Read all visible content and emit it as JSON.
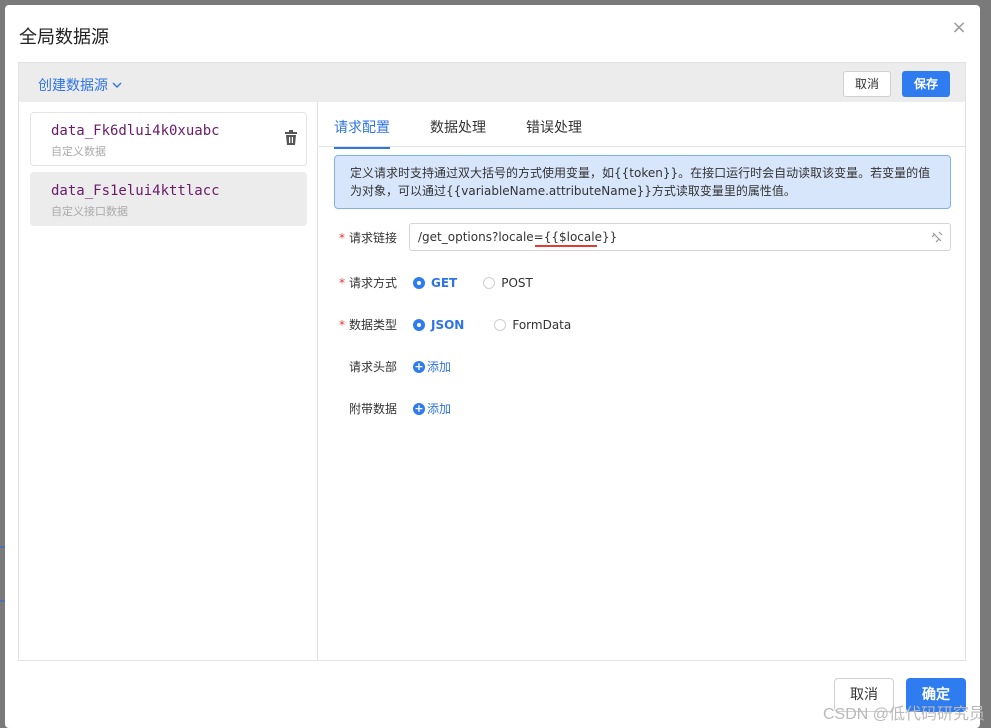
{
  "modal": {
    "title": "全局数据源",
    "close_icon": "×"
  },
  "toolbar": {
    "create_label": "创建数据源",
    "cancel_label": "取消",
    "save_label": "保存"
  },
  "datasources": [
    {
      "name": "data_Fk6dlui4k0xuabc",
      "type": "自定义数据",
      "active": false
    },
    {
      "name": "data_Fs1elui4kttlacc",
      "type": "自定义接口数据",
      "active": true
    }
  ],
  "tabs": [
    {
      "label": "请求配置",
      "active": true
    },
    {
      "label": "数据处理",
      "active": false
    },
    {
      "label": "错误处理",
      "active": false
    }
  ],
  "notice": "定义请求时支持通过双大括号的方式使用变量，如{{token}}。在接口运行时会自动读取该变量。若变量的值为对象，可以通过{{variableName.attributeName}}方式读取变量里的属性值。",
  "form": {
    "url_label": "请求链接",
    "url_value": "/get_options?locale={{$locale}}",
    "method_label": "请求方式",
    "method_options": [
      "GET",
      "POST"
    ],
    "method_selected": "GET",
    "datatype_label": "数据类型",
    "datatype_options": [
      "JSON",
      "FormData"
    ],
    "datatype_selected": "JSON",
    "headers_label": "请求头部",
    "headers_add": "添加",
    "extra_label": "附带数据",
    "extra_add": "添加"
  },
  "footer": {
    "cancel_label": "取消",
    "ok_label": "确定"
  },
  "watermark": "CSDN @低代码研究员",
  "colors": {
    "primary": "#2f7cf0",
    "required": "#e53935",
    "ds_name": "#6a1b6a"
  }
}
